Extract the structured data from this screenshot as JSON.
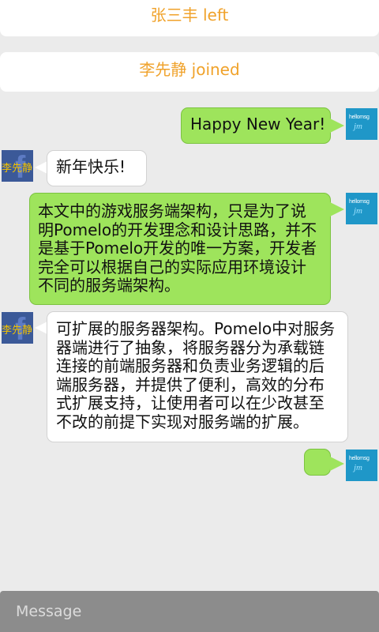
{
  "system_messages": [
    {
      "text": "张三丰 left"
    },
    {
      "text": "李先静 joined"
    }
  ],
  "messages": [
    {
      "side": "right",
      "text": "Happy New Year!",
      "avatar": "logo-avatar"
    },
    {
      "side": "left",
      "text": "新年快乐!",
      "avatar_label": "李先静"
    },
    {
      "side": "right",
      "lines": [
        "本文中的游戏服务端架构，只是为了说",
        "明Pomelo的开发理念和设计思路，并不",
        "是基于Pomelo开发的唯一方案，开发者",
        "完全可以根据自己的实际应用环境设计",
        "不同的服务端架构。"
      ]
    },
    {
      "side": "left",
      "avatar_label": "李先静",
      "lines": [
        "可扩展的服务器架构。Pomelo中对服务",
        "器端进行了抽象，将服务器分为承载链",
        "连接的前端服务器和负责业务逻辑的后",
        "端服务器，并提供了便利，高效的分布",
        "式扩展支持，让使用者可以在少改甚至",
        "不改的前提下实现对服务端的扩展。"
      ]
    },
    {
      "side": "right",
      "text": ""
    }
  ],
  "logo": {
    "top": "hellomsg",
    "bottom": "jm"
  },
  "composer": {
    "placeholder": "Message"
  },
  "colors": {
    "right_bubble": "#9ee45c",
    "left_bubble": "#ffffff",
    "system_text": "#f0a22a",
    "background": "#ebebeb"
  }
}
